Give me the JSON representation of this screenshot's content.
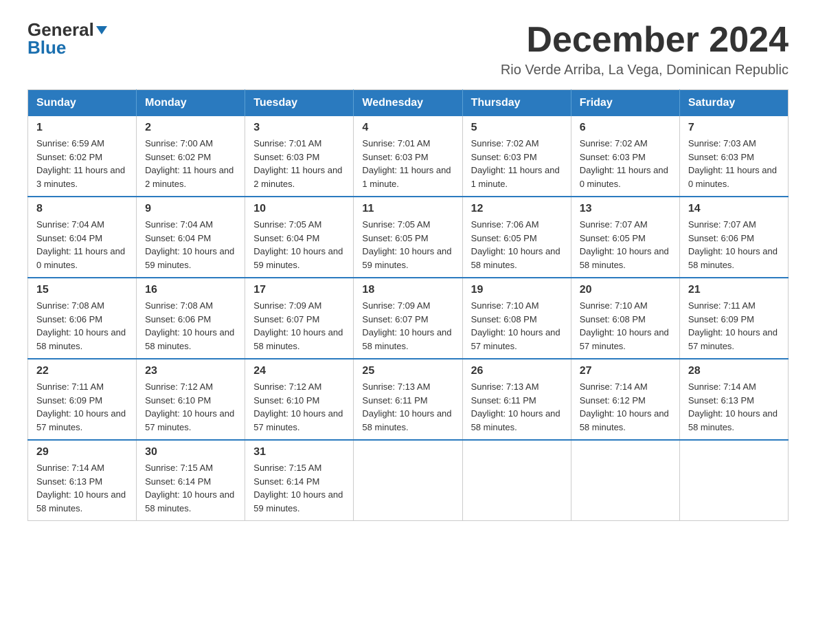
{
  "logo": {
    "general": "General",
    "blue": "Blue",
    "arrow_char": "▶"
  },
  "title": "December 2024",
  "subtitle": "Rio Verde Arriba, La Vega, Dominican Republic",
  "days_of_week": [
    "Sunday",
    "Monday",
    "Tuesday",
    "Wednesday",
    "Thursday",
    "Friday",
    "Saturday"
  ],
  "weeks": [
    [
      {
        "day": "1",
        "sunrise": "6:59 AM",
        "sunset": "6:02 PM",
        "daylight": "11 hours and 3 minutes."
      },
      {
        "day": "2",
        "sunrise": "7:00 AM",
        "sunset": "6:02 PM",
        "daylight": "11 hours and 2 minutes."
      },
      {
        "day": "3",
        "sunrise": "7:01 AM",
        "sunset": "6:03 PM",
        "daylight": "11 hours and 2 minutes."
      },
      {
        "day": "4",
        "sunrise": "7:01 AM",
        "sunset": "6:03 PM",
        "daylight": "11 hours and 1 minute."
      },
      {
        "day": "5",
        "sunrise": "7:02 AM",
        "sunset": "6:03 PM",
        "daylight": "11 hours and 1 minute."
      },
      {
        "day": "6",
        "sunrise": "7:02 AM",
        "sunset": "6:03 PM",
        "daylight": "11 hours and 0 minutes."
      },
      {
        "day": "7",
        "sunrise": "7:03 AM",
        "sunset": "6:03 PM",
        "daylight": "11 hours and 0 minutes."
      }
    ],
    [
      {
        "day": "8",
        "sunrise": "7:04 AM",
        "sunset": "6:04 PM",
        "daylight": "11 hours and 0 minutes."
      },
      {
        "day": "9",
        "sunrise": "7:04 AM",
        "sunset": "6:04 PM",
        "daylight": "10 hours and 59 minutes."
      },
      {
        "day": "10",
        "sunrise": "7:05 AM",
        "sunset": "6:04 PM",
        "daylight": "10 hours and 59 minutes."
      },
      {
        "day": "11",
        "sunrise": "7:05 AM",
        "sunset": "6:05 PM",
        "daylight": "10 hours and 59 minutes."
      },
      {
        "day": "12",
        "sunrise": "7:06 AM",
        "sunset": "6:05 PM",
        "daylight": "10 hours and 58 minutes."
      },
      {
        "day": "13",
        "sunrise": "7:07 AM",
        "sunset": "6:05 PM",
        "daylight": "10 hours and 58 minutes."
      },
      {
        "day": "14",
        "sunrise": "7:07 AM",
        "sunset": "6:06 PM",
        "daylight": "10 hours and 58 minutes."
      }
    ],
    [
      {
        "day": "15",
        "sunrise": "7:08 AM",
        "sunset": "6:06 PM",
        "daylight": "10 hours and 58 minutes."
      },
      {
        "day": "16",
        "sunrise": "7:08 AM",
        "sunset": "6:06 PM",
        "daylight": "10 hours and 58 minutes."
      },
      {
        "day": "17",
        "sunrise": "7:09 AM",
        "sunset": "6:07 PM",
        "daylight": "10 hours and 58 minutes."
      },
      {
        "day": "18",
        "sunrise": "7:09 AM",
        "sunset": "6:07 PM",
        "daylight": "10 hours and 58 minutes."
      },
      {
        "day": "19",
        "sunrise": "7:10 AM",
        "sunset": "6:08 PM",
        "daylight": "10 hours and 57 minutes."
      },
      {
        "day": "20",
        "sunrise": "7:10 AM",
        "sunset": "6:08 PM",
        "daylight": "10 hours and 57 minutes."
      },
      {
        "day": "21",
        "sunrise": "7:11 AM",
        "sunset": "6:09 PM",
        "daylight": "10 hours and 57 minutes."
      }
    ],
    [
      {
        "day": "22",
        "sunrise": "7:11 AM",
        "sunset": "6:09 PM",
        "daylight": "10 hours and 57 minutes."
      },
      {
        "day": "23",
        "sunrise": "7:12 AM",
        "sunset": "6:10 PM",
        "daylight": "10 hours and 57 minutes."
      },
      {
        "day": "24",
        "sunrise": "7:12 AM",
        "sunset": "6:10 PM",
        "daylight": "10 hours and 57 minutes."
      },
      {
        "day": "25",
        "sunrise": "7:13 AM",
        "sunset": "6:11 PM",
        "daylight": "10 hours and 58 minutes."
      },
      {
        "day": "26",
        "sunrise": "7:13 AM",
        "sunset": "6:11 PM",
        "daylight": "10 hours and 58 minutes."
      },
      {
        "day": "27",
        "sunrise": "7:14 AM",
        "sunset": "6:12 PM",
        "daylight": "10 hours and 58 minutes."
      },
      {
        "day": "28",
        "sunrise": "7:14 AM",
        "sunset": "6:13 PM",
        "daylight": "10 hours and 58 minutes."
      }
    ],
    [
      {
        "day": "29",
        "sunrise": "7:14 AM",
        "sunset": "6:13 PM",
        "daylight": "10 hours and 58 minutes."
      },
      {
        "day": "30",
        "sunrise": "7:15 AM",
        "sunset": "6:14 PM",
        "daylight": "10 hours and 58 minutes."
      },
      {
        "day": "31",
        "sunrise": "7:15 AM",
        "sunset": "6:14 PM",
        "daylight": "10 hours and 59 minutes."
      },
      null,
      null,
      null,
      null
    ]
  ]
}
